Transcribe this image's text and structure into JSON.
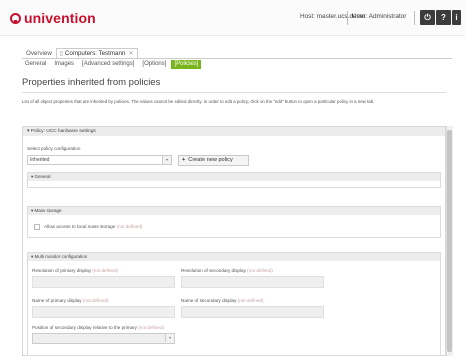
{
  "header": {
    "logo": "univention",
    "host": "Host: master.ucs.demo",
    "user": "User: Administrator",
    "buttons": [
      {
        "icon": "power-icon",
        "glyph": "⏻"
      },
      {
        "icon": "help-icon",
        "glyph": "?"
      },
      {
        "icon": "info-icon",
        "glyph": "i"
      },
      {
        "icon": "feedback-icon",
        "glyph": "✎"
      }
    ]
  },
  "tabs": [
    {
      "label": "Overview"
    },
    {
      "label": "Computers: Testmann",
      "icon": "computer-icon",
      "close": "✕"
    }
  ],
  "subtabs": [
    {
      "label": "General"
    },
    {
      "label": "Images"
    },
    {
      "label": "[Advanced settings]"
    },
    {
      "label": "[Options]"
    },
    {
      "label": "[Policies]"
    }
  ],
  "page": {
    "title": "Properties inherited from policies",
    "description": "List of all object properties that are inherited by policies. The values cannot be edited directly. In order to edit a policy, click on the \"edit\" button to open a particular policy in a new tab."
  },
  "policy_panel": {
    "title": "▾ Policy: UCC hardware settings",
    "select_label": "Select policy configuration",
    "select_value": "Inherited",
    "create_button": "Create new policy",
    "not_defined": "(not defined)",
    "sections": {
      "general": "▾ General",
      "mass_storage": "▾ Mass storage",
      "multi_monitor": "▾ Multi monitor configuration"
    },
    "mass_storage_checkbox": "Allow access to local mass storage",
    "fields": {
      "primary_resolution": "Resolution of primary display",
      "secondary_resolution": "Resolution of secondary display",
      "primary_name": "Name of primary display",
      "secondary_name": "Name of secondary display",
      "secondary_position": "Position of secondary display relative to the primary"
    }
  },
  "colors": {
    "brand": "#c8102e",
    "active_subtab": "#7ab51d"
  }
}
